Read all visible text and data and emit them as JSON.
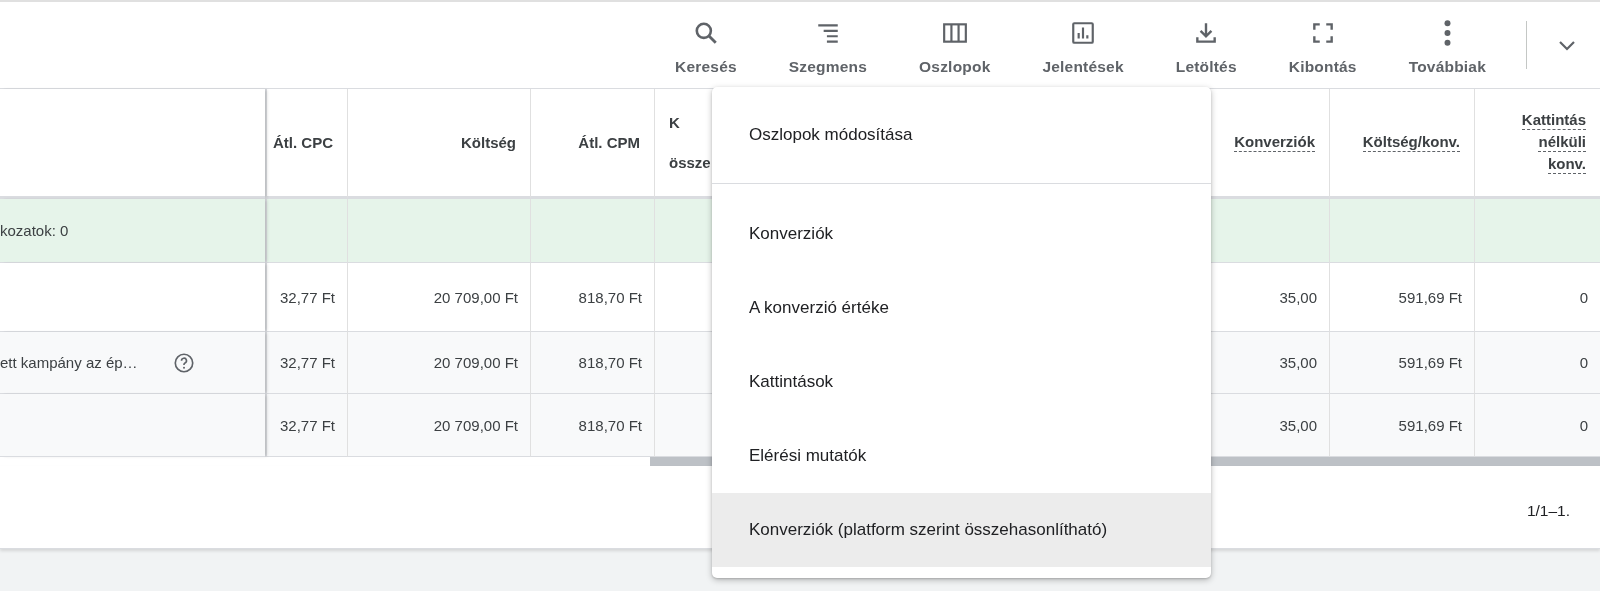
{
  "toolbar": {
    "buttons": [
      {
        "label": "Keresés"
      },
      {
        "label": "Szegmens"
      },
      {
        "label": "Oszlopok"
      },
      {
        "label": "Jelentések"
      },
      {
        "label": "Letöltés"
      },
      {
        "label": "Kibontás"
      },
      {
        "label": "Továbbiak"
      }
    ]
  },
  "table": {
    "columns": [
      {
        "lines": [
          "Átl. CPC"
        ],
        "dashed": false
      },
      {
        "lines": [
          "Költség"
        ],
        "dashed": false
      },
      {
        "lines": [
          "Átl. CPM"
        ],
        "dashed": false
      },
      {
        "lines": [
          "K",
          "össze"
        ],
        "dashed": false
      },
      {
        "lines": [
          "Konverziók"
        ],
        "dashed": true
      },
      {
        "lines": [
          "Költség/konv."
        ],
        "dashed": true
      },
      {
        "lines": [
          "Kattintás",
          "nélküli",
          "konv."
        ],
        "dashed": true
      }
    ],
    "rows": [
      {
        "kind": "filter",
        "label": "kozatok: 0"
      },
      {
        "kind": "plain",
        "values": [
          "32,77 Ft",
          "20 709,00 Ft",
          "818,70 Ft",
          "35,00",
          "591,69 Ft",
          "0"
        ]
      },
      {
        "kind": "shaded",
        "label": "ett kampány az ép…",
        "help": true,
        "values": [
          "32,77 Ft",
          "20 709,00 Ft",
          "818,70 Ft",
          "35,00",
          "591,69 Ft",
          "0"
        ]
      },
      {
        "kind": "shaded",
        "values": [
          "32,77 Ft",
          "20 709,00 Ft",
          "818,70 Ft",
          "35,00",
          "591,69 Ft",
          "0"
        ]
      }
    ]
  },
  "pagination": "1/1–1.",
  "menu": {
    "title": "Oszlopok módosítása",
    "items": [
      {
        "label": "Konverziók",
        "selected": false
      },
      {
        "label": "A konverzió értéke",
        "selected": false
      },
      {
        "label": "Kattintások",
        "selected": false
      },
      {
        "label": "Elérési mutatók",
        "selected": false
      },
      {
        "label": "Konverziók (platform szerint összehasonlítható)",
        "selected": true
      }
    ]
  }
}
